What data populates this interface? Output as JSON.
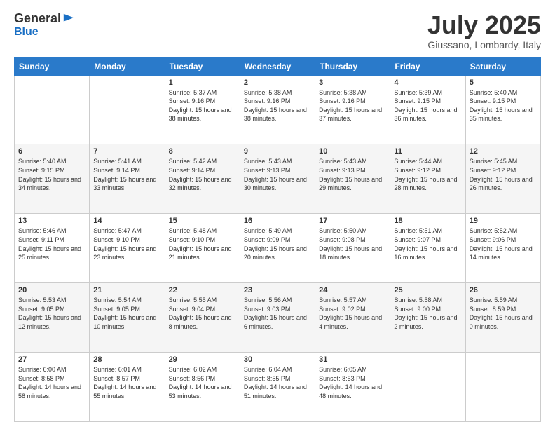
{
  "header": {
    "logo_general": "General",
    "logo_blue": "Blue",
    "month_title": "July 2025",
    "location": "Giussano, Lombardy, Italy"
  },
  "days_of_week": [
    "Sunday",
    "Monday",
    "Tuesday",
    "Wednesday",
    "Thursday",
    "Friday",
    "Saturday"
  ],
  "weeks": [
    [
      {
        "day": "",
        "info": ""
      },
      {
        "day": "",
        "info": ""
      },
      {
        "day": "1",
        "info": "Sunrise: 5:37 AM\nSunset: 9:16 PM\nDaylight: 15 hours and 38 minutes."
      },
      {
        "day": "2",
        "info": "Sunrise: 5:38 AM\nSunset: 9:16 PM\nDaylight: 15 hours and 38 minutes."
      },
      {
        "day": "3",
        "info": "Sunrise: 5:38 AM\nSunset: 9:16 PM\nDaylight: 15 hours and 37 minutes."
      },
      {
        "day": "4",
        "info": "Sunrise: 5:39 AM\nSunset: 9:15 PM\nDaylight: 15 hours and 36 minutes."
      },
      {
        "day": "5",
        "info": "Sunrise: 5:40 AM\nSunset: 9:15 PM\nDaylight: 15 hours and 35 minutes."
      }
    ],
    [
      {
        "day": "6",
        "info": "Sunrise: 5:40 AM\nSunset: 9:15 PM\nDaylight: 15 hours and 34 minutes."
      },
      {
        "day": "7",
        "info": "Sunrise: 5:41 AM\nSunset: 9:14 PM\nDaylight: 15 hours and 33 minutes."
      },
      {
        "day": "8",
        "info": "Sunrise: 5:42 AM\nSunset: 9:14 PM\nDaylight: 15 hours and 32 minutes."
      },
      {
        "day": "9",
        "info": "Sunrise: 5:43 AM\nSunset: 9:13 PM\nDaylight: 15 hours and 30 minutes."
      },
      {
        "day": "10",
        "info": "Sunrise: 5:43 AM\nSunset: 9:13 PM\nDaylight: 15 hours and 29 minutes."
      },
      {
        "day": "11",
        "info": "Sunrise: 5:44 AM\nSunset: 9:12 PM\nDaylight: 15 hours and 28 minutes."
      },
      {
        "day": "12",
        "info": "Sunrise: 5:45 AM\nSunset: 9:12 PM\nDaylight: 15 hours and 26 minutes."
      }
    ],
    [
      {
        "day": "13",
        "info": "Sunrise: 5:46 AM\nSunset: 9:11 PM\nDaylight: 15 hours and 25 minutes."
      },
      {
        "day": "14",
        "info": "Sunrise: 5:47 AM\nSunset: 9:10 PM\nDaylight: 15 hours and 23 minutes."
      },
      {
        "day": "15",
        "info": "Sunrise: 5:48 AM\nSunset: 9:10 PM\nDaylight: 15 hours and 21 minutes."
      },
      {
        "day": "16",
        "info": "Sunrise: 5:49 AM\nSunset: 9:09 PM\nDaylight: 15 hours and 20 minutes."
      },
      {
        "day": "17",
        "info": "Sunrise: 5:50 AM\nSunset: 9:08 PM\nDaylight: 15 hours and 18 minutes."
      },
      {
        "day": "18",
        "info": "Sunrise: 5:51 AM\nSunset: 9:07 PM\nDaylight: 15 hours and 16 minutes."
      },
      {
        "day": "19",
        "info": "Sunrise: 5:52 AM\nSunset: 9:06 PM\nDaylight: 15 hours and 14 minutes."
      }
    ],
    [
      {
        "day": "20",
        "info": "Sunrise: 5:53 AM\nSunset: 9:05 PM\nDaylight: 15 hours and 12 minutes."
      },
      {
        "day": "21",
        "info": "Sunrise: 5:54 AM\nSunset: 9:05 PM\nDaylight: 15 hours and 10 minutes."
      },
      {
        "day": "22",
        "info": "Sunrise: 5:55 AM\nSunset: 9:04 PM\nDaylight: 15 hours and 8 minutes."
      },
      {
        "day": "23",
        "info": "Sunrise: 5:56 AM\nSunset: 9:03 PM\nDaylight: 15 hours and 6 minutes."
      },
      {
        "day": "24",
        "info": "Sunrise: 5:57 AM\nSunset: 9:02 PM\nDaylight: 15 hours and 4 minutes."
      },
      {
        "day": "25",
        "info": "Sunrise: 5:58 AM\nSunset: 9:00 PM\nDaylight: 15 hours and 2 minutes."
      },
      {
        "day": "26",
        "info": "Sunrise: 5:59 AM\nSunset: 8:59 PM\nDaylight: 15 hours and 0 minutes."
      }
    ],
    [
      {
        "day": "27",
        "info": "Sunrise: 6:00 AM\nSunset: 8:58 PM\nDaylight: 14 hours and 58 minutes."
      },
      {
        "day": "28",
        "info": "Sunrise: 6:01 AM\nSunset: 8:57 PM\nDaylight: 14 hours and 55 minutes."
      },
      {
        "day": "29",
        "info": "Sunrise: 6:02 AM\nSunset: 8:56 PM\nDaylight: 14 hours and 53 minutes."
      },
      {
        "day": "30",
        "info": "Sunrise: 6:04 AM\nSunset: 8:55 PM\nDaylight: 14 hours and 51 minutes."
      },
      {
        "day": "31",
        "info": "Sunrise: 6:05 AM\nSunset: 8:53 PM\nDaylight: 14 hours and 48 minutes."
      },
      {
        "day": "",
        "info": ""
      },
      {
        "day": "",
        "info": ""
      }
    ]
  ]
}
